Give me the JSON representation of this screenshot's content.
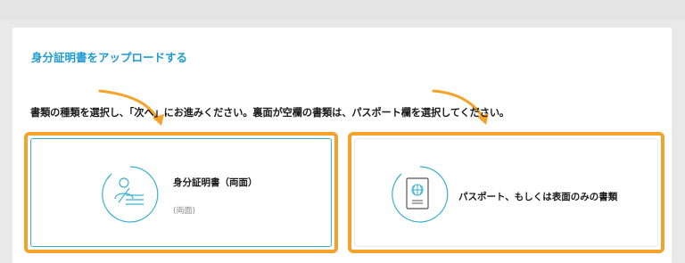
{
  "page": {
    "title": "身分証明書をアップロードする",
    "instruction": "書類の種類を選択し、「次へ」にお進みください。裏面が空欄の書類は、パスポート欄を選択してください。"
  },
  "options": [
    {
      "label": "身分証明書（両面）",
      "sublabel": "(両面)",
      "icon": "id-card-icon",
      "selected": true
    },
    {
      "label": "パスポート、もしくは表面のみの書類",
      "icon": "passport-icon",
      "selected": false
    }
  ],
  "colors": {
    "accent": "#1f9bcf",
    "highlight": "#f5a22a",
    "selected_border": "#3ab0cf"
  }
}
